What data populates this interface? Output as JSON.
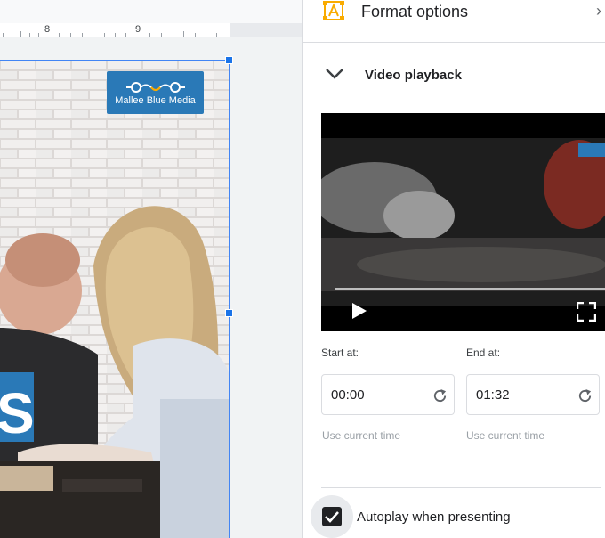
{
  "ruler": {
    "marks": [
      "8",
      "9"
    ]
  },
  "slide": {
    "logo_text": "Mallee Blue Media"
  },
  "panel": {
    "title": "Format options",
    "close_glyph": "›",
    "section_title": "Video playback",
    "start": {
      "label": "Start at:",
      "value": "00:00",
      "use_current": "Use current time"
    },
    "end": {
      "label": "End at:",
      "value": "01:32",
      "use_current": "Use current time"
    },
    "autoplay": {
      "label": "Autoplay when presenting",
      "checked": true
    }
  },
  "colors": {
    "accent": "#1a73e8",
    "logo_blue": "#2a79b7",
    "format_icon": "#f9ab00"
  },
  "icons": {
    "format": "format-options-icon",
    "collapse": "chevron-down-icon",
    "play": "play-icon",
    "fullscreen": "fullscreen-icon",
    "refresh": "refresh-icon",
    "check": "check-icon",
    "close": "close-icon"
  }
}
